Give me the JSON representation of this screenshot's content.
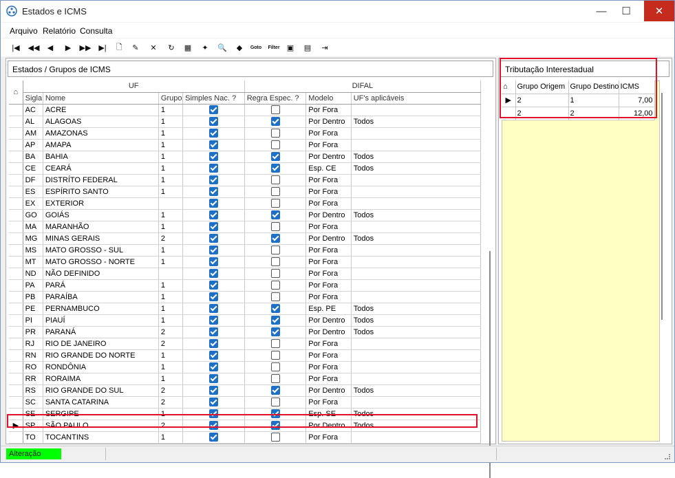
{
  "window": {
    "title": "Estados e ICMS",
    "minimize": "—",
    "maximize": "☐",
    "close": "✕"
  },
  "menu": [
    "Arquivo",
    "Relatório",
    "Consulta"
  ],
  "toolbar": [
    {
      "icon": "first-record-icon",
      "glyph": "|◀"
    },
    {
      "icon": "prior-page-icon",
      "glyph": "◀◀"
    },
    {
      "icon": "prior-record-icon",
      "glyph": "◀"
    },
    {
      "icon": "next-record-icon",
      "glyph": "▶"
    },
    {
      "icon": "next-page-icon",
      "glyph": "▶▶"
    },
    {
      "icon": "last-record-icon",
      "glyph": "▶|"
    },
    {
      "icon": "new-icon",
      "glyph": "🗋"
    },
    {
      "icon": "edit-icon",
      "glyph": "✎"
    },
    {
      "icon": "delete-icon",
      "glyph": "✕"
    },
    {
      "icon": "refresh-icon",
      "glyph": "↻"
    },
    {
      "icon": "properties-icon",
      "glyph": "▦"
    },
    {
      "icon": "wand-icon",
      "glyph": "✦"
    },
    {
      "icon": "print-preview-icon",
      "glyph": "🔍"
    },
    {
      "icon": "eraser-icon",
      "glyph": "◆"
    },
    {
      "icon": "goto-icon",
      "glyph": "Goto"
    },
    {
      "icon": "filter-icon",
      "glyph": "Filter"
    },
    {
      "icon": "image-icon",
      "glyph": "▣"
    },
    {
      "icon": "export-icon",
      "glyph": "▤"
    },
    {
      "icon": "exit-icon",
      "glyph": "⇥"
    }
  ],
  "left_panel": {
    "title": "Estados / Grupos de ICMS",
    "bands": {
      "uf": "UF",
      "difal": "DIFAL"
    },
    "columns": [
      "Sigla",
      "Nome",
      "Grupo",
      "Simples Nac. ?",
      "Regra Espec. ?",
      "Modelo",
      "UF's aplicáveis"
    ],
    "rows": [
      {
        "sigla": "AC",
        "nome": "ACRE",
        "grupo": "1",
        "simples": true,
        "regra": false,
        "modelo": "Por Fora",
        "ufs": ""
      },
      {
        "sigla": "AL",
        "nome": "ALAGOAS",
        "grupo": "1",
        "simples": true,
        "regra": true,
        "modelo": "Por Dentro",
        "ufs": "Todos"
      },
      {
        "sigla": "AM",
        "nome": "AMAZONAS",
        "grupo": "1",
        "simples": true,
        "regra": false,
        "modelo": "Por Fora",
        "ufs": ""
      },
      {
        "sigla": "AP",
        "nome": "AMAPA",
        "grupo": "1",
        "simples": true,
        "regra": false,
        "modelo": "Por Fora",
        "ufs": ""
      },
      {
        "sigla": "BA",
        "nome": "BAHIA",
        "grupo": "1",
        "simples": true,
        "regra": true,
        "modelo": "Por Dentro",
        "ufs": "Todos"
      },
      {
        "sigla": "CE",
        "nome": "CEARÁ",
        "grupo": "1",
        "simples": true,
        "regra": true,
        "modelo": "Esp. CE",
        "ufs": "Todos"
      },
      {
        "sigla": "DF",
        "nome": "DISTRÍTO FEDERAL",
        "grupo": "1",
        "simples": true,
        "regra": false,
        "modelo": "Por Fora",
        "ufs": ""
      },
      {
        "sigla": "ES",
        "nome": "ESPÍRITO SANTO",
        "grupo": "1",
        "simples": true,
        "regra": false,
        "modelo": "Por Fora",
        "ufs": ""
      },
      {
        "sigla": "EX",
        "nome": "EXTERIOR",
        "grupo": "",
        "simples": true,
        "regra": false,
        "modelo": "Por Fora",
        "ufs": ""
      },
      {
        "sigla": "GO",
        "nome": "GOIÁS",
        "grupo": "1",
        "simples": true,
        "regra": true,
        "modelo": "Por Dentro",
        "ufs": "Todos"
      },
      {
        "sigla": "MA",
        "nome": "MARANHÃO",
        "grupo": "1",
        "simples": true,
        "regra": false,
        "modelo": "Por Fora",
        "ufs": ""
      },
      {
        "sigla": "MG",
        "nome": "MINAS GERAIS",
        "grupo": "2",
        "simples": true,
        "regra": true,
        "modelo": "Por Dentro",
        "ufs": "Todos"
      },
      {
        "sigla": "MS",
        "nome": "MATO GROSSO - SUL",
        "grupo": "1",
        "simples": true,
        "regra": false,
        "modelo": "Por Fora",
        "ufs": ""
      },
      {
        "sigla": "MT",
        "nome": "MATO GROSSO - NORTE",
        "grupo": "1",
        "simples": true,
        "regra": false,
        "modelo": "Por Fora",
        "ufs": ""
      },
      {
        "sigla": "ND",
        "nome": "NÃO DEFINIDO",
        "grupo": "",
        "simples": true,
        "regra": false,
        "modelo": "Por Fora",
        "ufs": ""
      },
      {
        "sigla": "PA",
        "nome": "PARÁ",
        "grupo": "1",
        "simples": true,
        "regra": false,
        "modelo": "Por Fora",
        "ufs": ""
      },
      {
        "sigla": "PB",
        "nome": "PARAÍBA",
        "grupo": "1",
        "simples": true,
        "regra": false,
        "modelo": "Por Fora",
        "ufs": ""
      },
      {
        "sigla": "PE",
        "nome": "PERNAMBUCO",
        "grupo": "1",
        "simples": true,
        "regra": true,
        "modelo": "Esp. PE",
        "ufs": "Todos"
      },
      {
        "sigla": "PI",
        "nome": "PIAUÍ",
        "grupo": "1",
        "simples": true,
        "regra": true,
        "modelo": "Por Dentro",
        "ufs": "Todos"
      },
      {
        "sigla": "PR",
        "nome": "PARANÁ",
        "grupo": "2",
        "simples": true,
        "regra": true,
        "modelo": "Por Dentro",
        "ufs": "Todos"
      },
      {
        "sigla": "RJ",
        "nome": "RIO DE JANEIRO",
        "grupo": "2",
        "simples": true,
        "regra": false,
        "modelo": "Por Fora",
        "ufs": ""
      },
      {
        "sigla": "RN",
        "nome": "RIO GRANDE DO NORTE",
        "grupo": "1",
        "simples": true,
        "regra": false,
        "modelo": "Por Fora",
        "ufs": ""
      },
      {
        "sigla": "RO",
        "nome": "RONDÔNIA",
        "grupo": "1",
        "simples": true,
        "regra": false,
        "modelo": "Por Fora",
        "ufs": ""
      },
      {
        "sigla": "RR",
        "nome": "RORAIMA",
        "grupo": "1",
        "simples": true,
        "regra": false,
        "modelo": "Por Fora",
        "ufs": ""
      },
      {
        "sigla": "RS",
        "nome": "RIO GRANDE DO SUL",
        "grupo": "2",
        "simples": true,
        "regra": true,
        "modelo": "Por Dentro",
        "ufs": "Todos"
      },
      {
        "sigla": "SC",
        "nome": "SANTA CATARINA",
        "grupo": "2",
        "simples": true,
        "regra": false,
        "modelo": "Por Fora",
        "ufs": ""
      },
      {
        "sigla": "SE",
        "nome": "SERGIPE",
        "grupo": "1",
        "simples": true,
        "regra": true,
        "modelo": "Esp. SE",
        "ufs": "Todos"
      },
      {
        "sigla": "SP",
        "nome": "SÃO PAULO",
        "grupo": "2",
        "simples": true,
        "regra": true,
        "modelo": "Por Dentro",
        "ufs": "Todos",
        "selected": true
      },
      {
        "sigla": "TO",
        "nome": "TOCANTINS",
        "grupo": "1",
        "simples": true,
        "regra": false,
        "modelo": "Por Fora",
        "ufs": ""
      }
    ]
  },
  "right_panel": {
    "title": "Tributação Interestadual",
    "columns": [
      "Grupo Origem",
      "Grupo Destino",
      "ICMS"
    ],
    "rows": [
      {
        "origem": "2",
        "destino": "1",
        "icms": "7,00",
        "selected": true
      },
      {
        "origem": "2",
        "destino": "2",
        "icms": "12,00"
      }
    ]
  },
  "status": {
    "mode": "Alteração"
  },
  "colors": {
    "highlight": "#e0102a",
    "status_badge": "#00ff00",
    "detail_bg": "#ffffc4",
    "checkbox": "#1e6fc6"
  }
}
